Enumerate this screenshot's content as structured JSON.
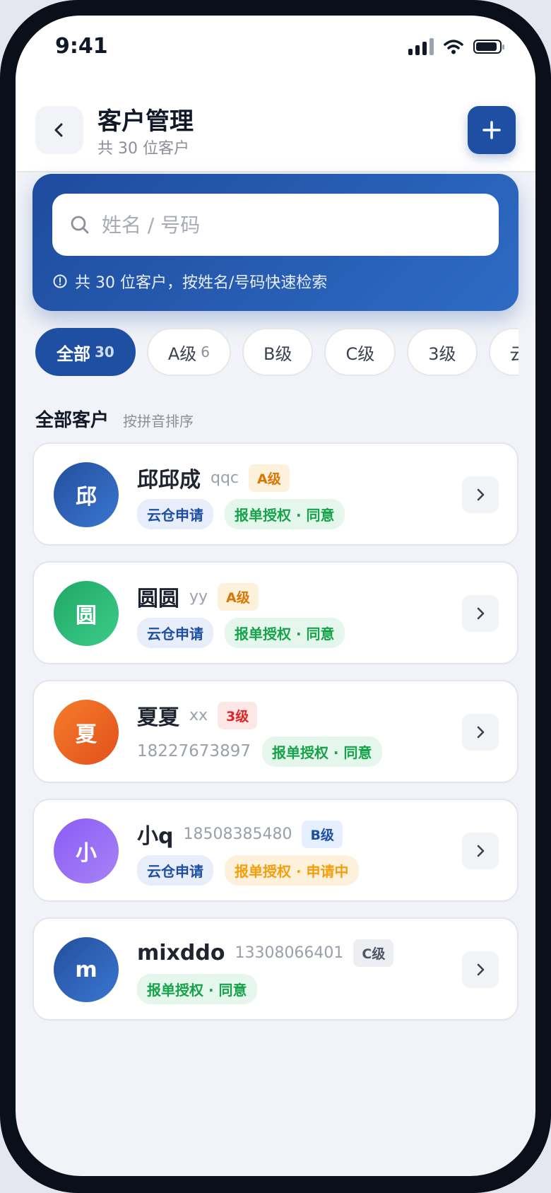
{
  "status": {
    "time": "9:41"
  },
  "header": {
    "title": "客户管理",
    "subtitle": "共 30 位客户"
  },
  "search": {
    "placeholder": "姓名 / 号码",
    "hint": "共 30 位客户，按姓名/号码快速检索"
  },
  "filters": [
    {
      "label": "全部",
      "count": "30",
      "active": true
    },
    {
      "label": "A级",
      "count": "6"
    },
    {
      "label": "B级",
      "count": ""
    },
    {
      "label": "C级",
      "count": ""
    },
    {
      "label": "3级",
      "count": ""
    },
    {
      "label": "云",
      "count": ""
    }
  ],
  "section": {
    "title": "全部客户",
    "subtitle": "按拼音排序"
  },
  "customers": [
    {
      "avatar": "邱",
      "avatar_color": "#2b5fb6",
      "name": "邱邱成",
      "code": "qqc",
      "level": "A级",
      "tags": [
        "云仓申请",
        "报单授权 · 同意"
      ]
    },
    {
      "avatar": "圆",
      "avatar_color": "#28b673",
      "name": "圆圆",
      "code": "yy",
      "level": "A级",
      "tags": [
        "云仓申请",
        "报单授权 · 同意"
      ]
    },
    {
      "avatar": "夏",
      "avatar_color": "#ee6a24",
      "name": "夏夏",
      "code": "xx",
      "level": "3级",
      "phone": "18227673897",
      "tags": [
        "报单授权 · 同意"
      ]
    },
    {
      "avatar": "小",
      "avatar_color": "#9468ee",
      "name": "小q",
      "code": "18508385480",
      "level": "B级",
      "tags": [
        "云仓申请",
        "报单授权 · 申请中"
      ]
    },
    {
      "avatar": "m",
      "avatar_color": "#2b5fb6",
      "name": "mixddo",
      "code": "13308066401",
      "level": "C级",
      "tags": [
        "报单授权 · 同意"
      ]
    }
  ]
}
